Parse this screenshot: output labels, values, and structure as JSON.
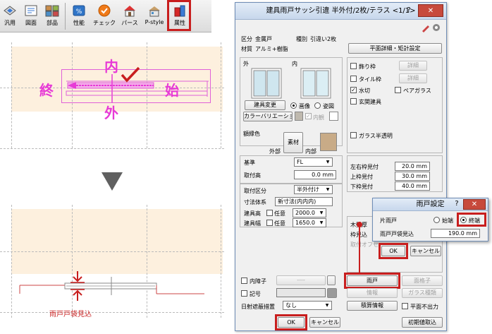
{
  "toolbar": {
    "items": [
      {
        "label": "汎用",
        "icon": "general-icon"
      },
      {
        "label": "図面",
        "icon": "drawing-icon"
      },
      {
        "label": "部品",
        "icon": "parts-icon"
      },
      {
        "label": "性能",
        "icon": "performance-icon"
      },
      {
        "label": "チェック",
        "icon": "check-icon"
      },
      {
        "label": "パース",
        "icon": "perspective-icon"
      },
      {
        "label": "P-style",
        "icon": "p-style-icon"
      },
      {
        "label": "属性",
        "icon": "attribute-icon"
      }
    ]
  },
  "diagram": {
    "top": {
      "inner": "内",
      "outer": "外",
      "end": "終",
      "start": "始"
    },
    "bottom": {
      "caption": "雨戸戸袋見込"
    }
  },
  "dialog": {
    "title": "建具雨戸サッシ引違 半外付/2枚/テラス <1/1>",
    "help": "?",
    "close": "✕",
    "kubun_label": "区分",
    "kubun_value": "金属戸",
    "shurui_label": "種別",
    "shurui_value": "引違い2枚",
    "zaishitsu_label": "材質",
    "zaishitsu_value": "アルミ+樹脂",
    "plan_detail_button": "平面詳細・矩計設定",
    "preview": {
      "outer": "外",
      "inner": "内"
    },
    "change_fitting_button": "建具変更",
    "radio_image": "画像",
    "radio_figure": "姿図",
    "color_variation_button": "カラーバリエーション",
    "inner_side_check": "内観",
    "frame_color_label": "額縁色",
    "material_button": "素材",
    "outer_label": "外部",
    "inner_label": "内部",
    "options": [
      {
        "label": "飾り枠",
        "checked": false,
        "detail": "詳細"
      },
      {
        "label": "タイル枠",
        "checked": false,
        "detail": "詳細"
      },
      {
        "label": "水切",
        "checked": true,
        "extra": "ペアガラス"
      },
      {
        "label": "玄関建具",
        "checked": false
      }
    ],
    "glass_translucent": "ガラス半透明",
    "kijun_label": "基準",
    "kijun_value": "FL",
    "toritsuke_label": "取付高",
    "toritsuke_value": "0.0 mm",
    "toritsuke_kubun_label": "取付区分",
    "toritsuke_kubun_value": "半外付け",
    "sunpo_label": "寸法体系",
    "sunpo_value": "新寸法(内内内)",
    "tateguma_label": "建具高",
    "tateguha_label": "建具幅",
    "nini": "任意",
    "height_value": "2000.0",
    "width_value": "1650.0",
    "mitsuke": [
      {
        "label": "左右枠見付",
        "value": "20.0 mm"
      },
      {
        "label": "上枠見付",
        "value": "30.0 mm"
      },
      {
        "label": "下枠見付",
        "value": "40.0 mm"
      }
    ],
    "kabeatsu_label": "木壁厚",
    "waku_label": "枠見込",
    "toritsuke_offset_label": "取付オフセ",
    "amado_button": "雨戸",
    "menkoshi_button": "面格子",
    "inner_shoji": "内障子",
    "inner_shoji_btn": "----",
    "kigou": "記号",
    "kigou_info_button": "情報",
    "glass_type_button": "ガラス種類",
    "nisha_label": "日射遮蔽措置",
    "nisha_value": "なし",
    "sekisan_button": "積算情報",
    "heimen_check": "平面不出力",
    "ok": "OK",
    "cancel": "キャンセル",
    "initial_button": "初期値取込"
  },
  "subdialog": {
    "title": "雨戸設定",
    "help": "?",
    "close": "✕",
    "kata_label": "片雨戸",
    "start_end": "始端",
    "end_end": "終端",
    "mikomi_label": "雨戸戸袋見込",
    "mikomi_value": "190.0 mm",
    "ok": "OK",
    "cancel": "キャンセル"
  }
}
